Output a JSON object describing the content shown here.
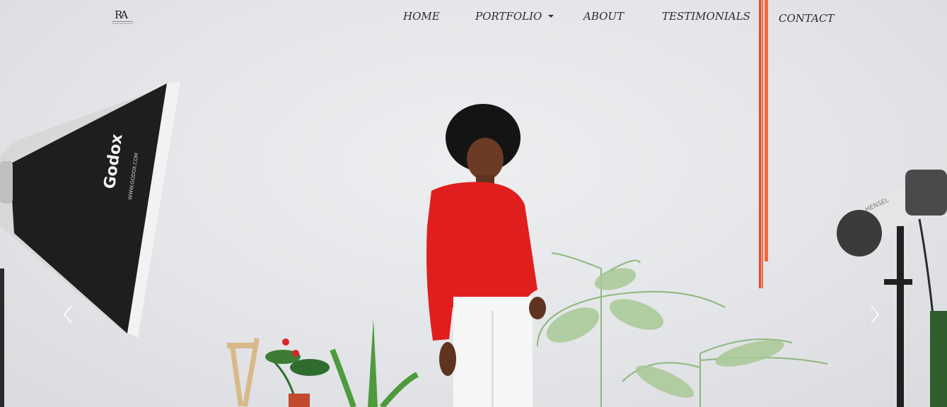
{
  "logo": {
    "mark": "RA"
  },
  "nav": {
    "home": "HOME",
    "portfolio": "PORTFOLIO",
    "about": "ABOUT",
    "testimonials": "TESTIMONIALS",
    "contact": "CONTACT"
  },
  "hero": {
    "softbox_brand": "Godox",
    "softbox_url": "WWW.GODOX.COM",
    "strobe_brand": "HENSEL"
  },
  "carousel": {
    "prev_icon": "chevron-left-icon",
    "next_icon": "chevron-right-icon"
  },
  "colors": {
    "sweater": "#e01e1e",
    "softbox": "#1f1f1f",
    "text": "#2d2d2d",
    "backdrop": "#e3e5e8"
  }
}
